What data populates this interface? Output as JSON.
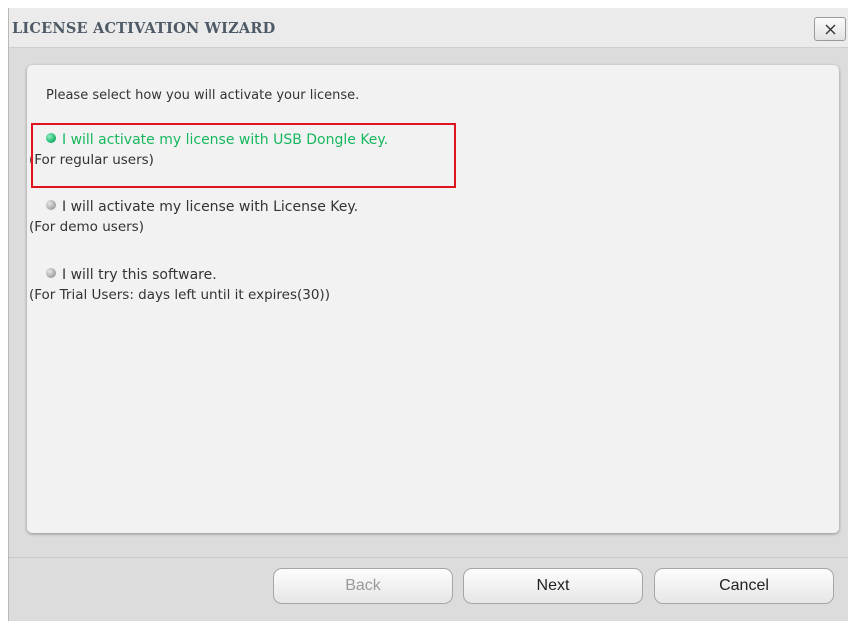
{
  "window": {
    "title": "LICENSE ACTIVATION WIZARD"
  },
  "content": {
    "prompt": "Please select how you will activate your license.",
    "options": [
      {
        "label": "I will activate my license with USB Dongle Key.",
        "sublabel": "(For regular users)",
        "selected": true
      },
      {
        "label": "I will activate my license with License Key.",
        "sublabel": "(For demo users)",
        "selected": false
      },
      {
        "label": "I will try this software.",
        "sublabel": "(For Trial Users: days left until it expires(30))",
        "selected": false
      }
    ]
  },
  "buttons": {
    "back": "Back",
    "next": "Next",
    "cancel": "Cancel"
  },
  "colors": {
    "selected_text": "#17b85e",
    "highlight_border": "#e0141e"
  }
}
